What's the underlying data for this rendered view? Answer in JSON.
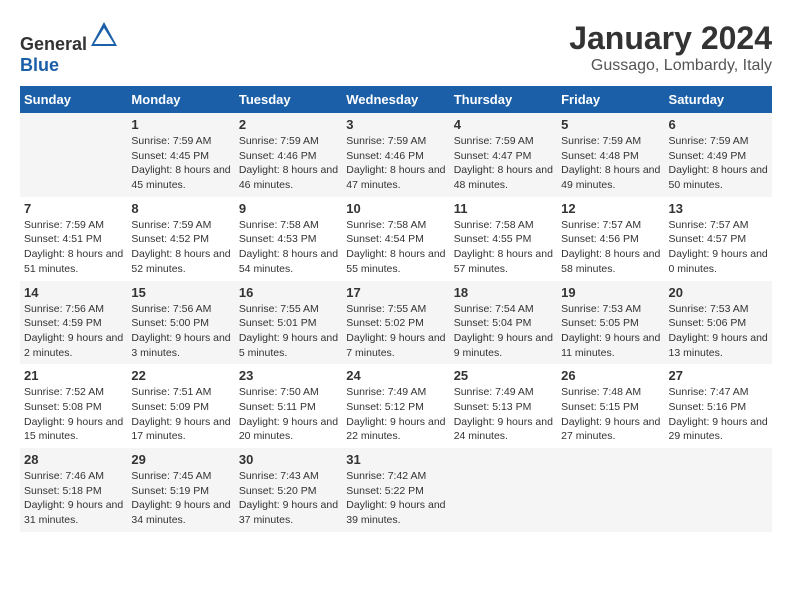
{
  "header": {
    "logo_general": "General",
    "logo_blue": "Blue",
    "month": "January 2024",
    "location": "Gussago, Lombardy, Italy"
  },
  "weekdays": [
    "Sunday",
    "Monday",
    "Tuesday",
    "Wednesday",
    "Thursday",
    "Friday",
    "Saturday"
  ],
  "weeks": [
    [
      {
        "day": "",
        "sunrise": "",
        "sunset": "",
        "daylight": ""
      },
      {
        "day": "1",
        "sunrise": "Sunrise: 7:59 AM",
        "sunset": "Sunset: 4:45 PM",
        "daylight": "Daylight: 8 hours and 45 minutes."
      },
      {
        "day": "2",
        "sunrise": "Sunrise: 7:59 AM",
        "sunset": "Sunset: 4:46 PM",
        "daylight": "Daylight: 8 hours and 46 minutes."
      },
      {
        "day": "3",
        "sunrise": "Sunrise: 7:59 AM",
        "sunset": "Sunset: 4:46 PM",
        "daylight": "Daylight: 8 hours and 47 minutes."
      },
      {
        "day": "4",
        "sunrise": "Sunrise: 7:59 AM",
        "sunset": "Sunset: 4:47 PM",
        "daylight": "Daylight: 8 hours and 48 minutes."
      },
      {
        "day": "5",
        "sunrise": "Sunrise: 7:59 AM",
        "sunset": "Sunset: 4:48 PM",
        "daylight": "Daylight: 8 hours and 49 minutes."
      },
      {
        "day": "6",
        "sunrise": "Sunrise: 7:59 AM",
        "sunset": "Sunset: 4:49 PM",
        "daylight": "Daylight: 8 hours and 50 minutes."
      }
    ],
    [
      {
        "day": "7",
        "sunrise": "Sunrise: 7:59 AM",
        "sunset": "Sunset: 4:51 PM",
        "daylight": "Daylight: 8 hours and 51 minutes."
      },
      {
        "day": "8",
        "sunrise": "Sunrise: 7:59 AM",
        "sunset": "Sunset: 4:52 PM",
        "daylight": "Daylight: 8 hours and 52 minutes."
      },
      {
        "day": "9",
        "sunrise": "Sunrise: 7:58 AM",
        "sunset": "Sunset: 4:53 PM",
        "daylight": "Daylight: 8 hours and 54 minutes."
      },
      {
        "day": "10",
        "sunrise": "Sunrise: 7:58 AM",
        "sunset": "Sunset: 4:54 PM",
        "daylight": "Daylight: 8 hours and 55 minutes."
      },
      {
        "day": "11",
        "sunrise": "Sunrise: 7:58 AM",
        "sunset": "Sunset: 4:55 PM",
        "daylight": "Daylight: 8 hours and 57 minutes."
      },
      {
        "day": "12",
        "sunrise": "Sunrise: 7:57 AM",
        "sunset": "Sunset: 4:56 PM",
        "daylight": "Daylight: 8 hours and 58 minutes."
      },
      {
        "day": "13",
        "sunrise": "Sunrise: 7:57 AM",
        "sunset": "Sunset: 4:57 PM",
        "daylight": "Daylight: 9 hours and 0 minutes."
      }
    ],
    [
      {
        "day": "14",
        "sunrise": "Sunrise: 7:56 AM",
        "sunset": "Sunset: 4:59 PM",
        "daylight": "Daylight: 9 hours and 2 minutes."
      },
      {
        "day": "15",
        "sunrise": "Sunrise: 7:56 AM",
        "sunset": "Sunset: 5:00 PM",
        "daylight": "Daylight: 9 hours and 3 minutes."
      },
      {
        "day": "16",
        "sunrise": "Sunrise: 7:55 AM",
        "sunset": "Sunset: 5:01 PM",
        "daylight": "Daylight: 9 hours and 5 minutes."
      },
      {
        "day": "17",
        "sunrise": "Sunrise: 7:55 AM",
        "sunset": "Sunset: 5:02 PM",
        "daylight": "Daylight: 9 hours and 7 minutes."
      },
      {
        "day": "18",
        "sunrise": "Sunrise: 7:54 AM",
        "sunset": "Sunset: 5:04 PM",
        "daylight": "Daylight: 9 hours and 9 minutes."
      },
      {
        "day": "19",
        "sunrise": "Sunrise: 7:53 AM",
        "sunset": "Sunset: 5:05 PM",
        "daylight": "Daylight: 9 hours and 11 minutes."
      },
      {
        "day": "20",
        "sunrise": "Sunrise: 7:53 AM",
        "sunset": "Sunset: 5:06 PM",
        "daylight": "Daylight: 9 hours and 13 minutes."
      }
    ],
    [
      {
        "day": "21",
        "sunrise": "Sunrise: 7:52 AM",
        "sunset": "Sunset: 5:08 PM",
        "daylight": "Daylight: 9 hours and 15 minutes."
      },
      {
        "day": "22",
        "sunrise": "Sunrise: 7:51 AM",
        "sunset": "Sunset: 5:09 PM",
        "daylight": "Daylight: 9 hours and 17 minutes."
      },
      {
        "day": "23",
        "sunrise": "Sunrise: 7:50 AM",
        "sunset": "Sunset: 5:11 PM",
        "daylight": "Daylight: 9 hours and 20 minutes."
      },
      {
        "day": "24",
        "sunrise": "Sunrise: 7:49 AM",
        "sunset": "Sunset: 5:12 PM",
        "daylight": "Daylight: 9 hours and 22 minutes."
      },
      {
        "day": "25",
        "sunrise": "Sunrise: 7:49 AM",
        "sunset": "Sunset: 5:13 PM",
        "daylight": "Daylight: 9 hours and 24 minutes."
      },
      {
        "day": "26",
        "sunrise": "Sunrise: 7:48 AM",
        "sunset": "Sunset: 5:15 PM",
        "daylight": "Daylight: 9 hours and 27 minutes."
      },
      {
        "day": "27",
        "sunrise": "Sunrise: 7:47 AM",
        "sunset": "Sunset: 5:16 PM",
        "daylight": "Daylight: 9 hours and 29 minutes."
      }
    ],
    [
      {
        "day": "28",
        "sunrise": "Sunrise: 7:46 AM",
        "sunset": "Sunset: 5:18 PM",
        "daylight": "Daylight: 9 hours and 31 minutes."
      },
      {
        "day": "29",
        "sunrise": "Sunrise: 7:45 AM",
        "sunset": "Sunset: 5:19 PM",
        "daylight": "Daylight: 9 hours and 34 minutes."
      },
      {
        "day": "30",
        "sunrise": "Sunrise: 7:43 AM",
        "sunset": "Sunset: 5:20 PM",
        "daylight": "Daylight: 9 hours and 37 minutes."
      },
      {
        "day": "31",
        "sunrise": "Sunrise: 7:42 AM",
        "sunset": "Sunset: 5:22 PM",
        "daylight": "Daylight: 9 hours and 39 minutes."
      },
      {
        "day": "",
        "sunrise": "",
        "sunset": "",
        "daylight": ""
      },
      {
        "day": "",
        "sunrise": "",
        "sunset": "",
        "daylight": ""
      },
      {
        "day": "",
        "sunrise": "",
        "sunset": "",
        "daylight": ""
      }
    ]
  ]
}
